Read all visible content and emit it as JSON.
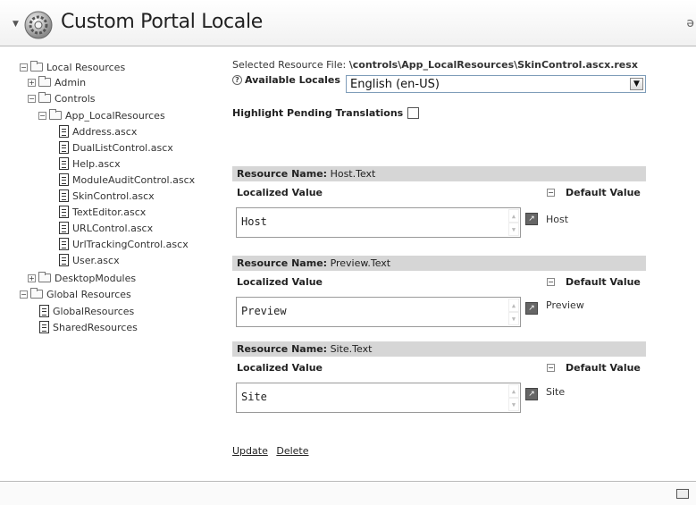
{
  "header": {
    "title": "Custom Portal Locale",
    "right_glyph": "ə"
  },
  "tree": {
    "items": [
      {
        "label": "Local Resources",
        "type": "folder",
        "exp": "−"
      },
      {
        "label": "Admin",
        "type": "folder",
        "exp": "+"
      },
      {
        "label": "Controls",
        "type": "folder",
        "exp": "−"
      },
      {
        "label": "App_LocalResources",
        "type": "folder",
        "exp": "−"
      },
      {
        "label": "Address.ascx",
        "type": "file"
      },
      {
        "label": "DualListControl.ascx",
        "type": "file"
      },
      {
        "label": "Help.ascx",
        "type": "file"
      },
      {
        "label": "ModuleAuditControl.ascx",
        "type": "file"
      },
      {
        "label": "SkinControl.ascx",
        "type": "file"
      },
      {
        "label": "TextEditor.ascx",
        "type": "file"
      },
      {
        "label": "URLControl.ascx",
        "type": "file"
      },
      {
        "label": "UrlTrackingControl.ascx",
        "type": "file"
      },
      {
        "label": "User.ascx",
        "type": "file"
      },
      {
        "label": "DesktopModules",
        "type": "folder",
        "exp": "+"
      },
      {
        "label": "Global Resources",
        "type": "folder",
        "exp": "−"
      },
      {
        "label": "GlobalResources",
        "type": "file"
      },
      {
        "label": "SharedResources",
        "type": "file"
      }
    ]
  },
  "main": {
    "selected_file_label": "Selected Resource File:",
    "selected_file_value": "\\controls\\App_LocalResources\\SkinControl.ascx.resx",
    "available_locales_label": "Available Locales",
    "locale_value": "English (en-US)",
    "highlight_label": "Highlight Pending Translations",
    "resources": [
      {
        "name_label": "Resource Name:",
        "name": "Host.Text",
        "localized_label": "Localized Value",
        "default_label": "Default Value",
        "value": "Host",
        "default": "Host"
      },
      {
        "name_label": "Resource Name:",
        "name": "Preview.Text",
        "localized_label": "Localized Value",
        "default_label": "Default Value",
        "value": "Preview",
        "default": "Preview"
      },
      {
        "name_label": "Resource Name:",
        "name": "Site.Text",
        "localized_label": "Localized Value",
        "default_label": "Default Value",
        "value": "Site",
        "default": "Site"
      }
    ],
    "update_link": "Update",
    "delete_link": "Delete"
  }
}
